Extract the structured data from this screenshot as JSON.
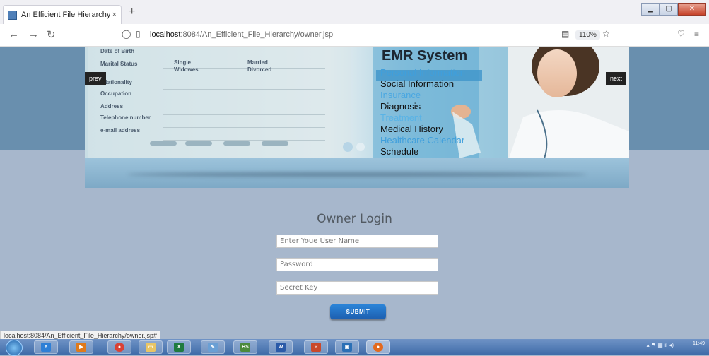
{
  "browser": {
    "tab_title": "An Efficient File Hierarchy Attri",
    "tab_close": "×",
    "new_tab": "+",
    "url_host": "localhost",
    "url_rest": ":8084/An_Efficient_File_Hierarchy/owner.jsp",
    "zoom": "110%",
    "status_url": "localhost:8084/An_Efficient_File_Hierarchy/owner.jsp#"
  },
  "slider": {
    "prev": "prev",
    "next": "next",
    "emr_title": "EMR System",
    "menu": [
      "Personal Information",
      "Social Information",
      "Insurance",
      "Diagnosis",
      "Treatment",
      "Medical History",
      "Healthcare Calendar",
      "Schedule"
    ],
    "form_labels": [
      "Date of Birth",
      "Marital Status",
      "Nationality",
      "Occupation",
      "Address",
      "Telephone number",
      "e-mail address"
    ],
    "marital_options": [
      "Single",
      "Married",
      "Widowes",
      "Divorced"
    ]
  },
  "login": {
    "title": "Owner Login",
    "username_placeholder": "Enter Youe User Name",
    "password_placeholder": "Password",
    "secret_placeholder": "Secret Key",
    "submit": "SUBMIT"
  },
  "taskbar": {
    "time": "11:49"
  },
  "colors": {
    "page_bg": "#a7b7cc",
    "band": "#698fae",
    "submit": "#1f66bd"
  }
}
